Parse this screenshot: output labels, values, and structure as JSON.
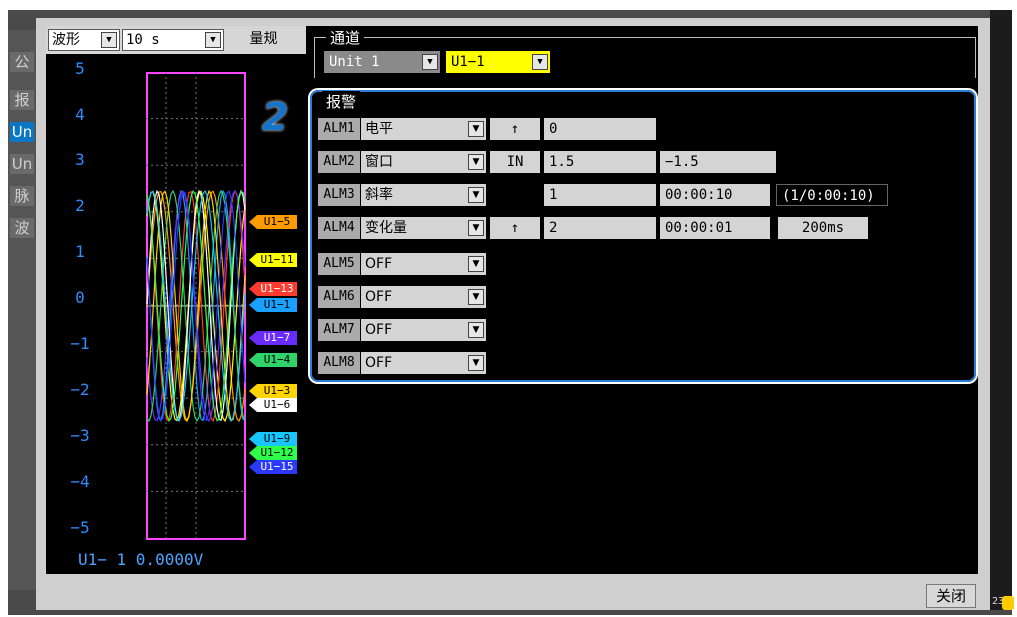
{
  "left_tabs": [
    "公",
    "报",
    "Un",
    "Un",
    "脉",
    "波"
  ],
  "active_tab_index": 2,
  "wave": {
    "mode_label": "波形",
    "timebase": "10 s",
    "scale_button": "量规",
    "y_labels": [
      "5",
      "4",
      "3",
      "2",
      "1",
      "0",
      "−1",
      "−2",
      "−3",
      "−4",
      "−5"
    ],
    "readout": "U1− 1 0.0000V",
    "channel_tags": [
      {
        "label": "U1−5",
        "color": "#ff9a00",
        "text": "#000"
      },
      {
        "label": "U1−11",
        "color": "#ffff00",
        "text": "#000"
      },
      {
        "label": "U1−13",
        "color": "#ff3b2f",
        "text": "#fff"
      },
      {
        "label": "U1−1",
        "color": "#1aa0ff",
        "text": "#000"
      },
      {
        "label": "U1−7",
        "color": "#6a2bff",
        "text": "#fff"
      },
      {
        "label": "U1−4",
        "color": "#2fd36a",
        "text": "#000"
      },
      {
        "label": "U1−3",
        "color": "#ffd400",
        "text": "#000"
      },
      {
        "label": "U1−6",
        "color": "#ffffff",
        "text": "#000"
      },
      {
        "label": "U1−9",
        "color": "#17c6ff",
        "text": "#000"
      },
      {
        "label": "U1−12",
        "color": "#2fff4a",
        "text": "#000"
      },
      {
        "label": "U1−15",
        "color": "#2a39ff",
        "text": "#fff"
      }
    ]
  },
  "channel": {
    "section_title": "通道",
    "unit_value": "Unit 1",
    "ch_value": "U1−1",
    "ch_color": "#ffff00"
  },
  "alarm": {
    "section_title": "报警",
    "step_marker": "2",
    "rows": [
      {
        "name": "ALM1",
        "type": "电平",
        "dir": "↑",
        "v1": "0",
        "v2": "",
        "v3": ""
      },
      {
        "name": "ALM2",
        "type": "窗口",
        "dir": "IN",
        "v1": "1.5",
        "v2": "−1.5",
        "v3": ""
      },
      {
        "name": "ALM3",
        "type": "斜率",
        "dir": "",
        "v1": "1",
        "v2": "00:00:10",
        "v3": "(1/0:00:10)"
      },
      {
        "name": "ALM4",
        "type": "变化量",
        "dir": "↑",
        "v1": "2",
        "v2": "00:00:01",
        "v3": "200ms"
      },
      {
        "name": "ALM5",
        "type": "OFF",
        "dir": "",
        "v1": "",
        "v2": "",
        "v3": ""
      },
      {
        "name": "ALM6",
        "type": "OFF",
        "dir": "",
        "v1": "",
        "v2": "",
        "v3": ""
      },
      {
        "name": "ALM7",
        "type": "OFF",
        "dir": "",
        "v1": "",
        "v2": "",
        "v3": ""
      },
      {
        "name": "ALM8",
        "type": "OFF",
        "dir": "",
        "v1": "",
        "v2": "",
        "v3": ""
      }
    ]
  },
  "footer": {
    "close_label": "关闭",
    "corner_text": "23"
  }
}
